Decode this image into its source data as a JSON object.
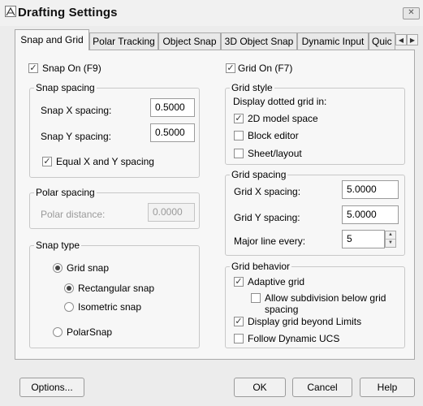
{
  "window": {
    "title": "Drafting Settings",
    "close_glyph": "✕"
  },
  "tabs": [
    {
      "label": "Snap and Grid",
      "active": true
    },
    {
      "label": "Polar Tracking"
    },
    {
      "label": "Object Snap"
    },
    {
      "label": "3D Object Snap"
    },
    {
      "label": "Dynamic Input"
    },
    {
      "label": "Quic"
    }
  ],
  "tab_scroll": {
    "left": "◀",
    "right": "▶"
  },
  "snap": {
    "snap_on": {
      "label": "Snap On (F9)",
      "checked": true
    },
    "spacing": {
      "title": "Snap spacing",
      "x_label": "Snap X spacing:",
      "x_value": "0.5000",
      "y_label": "Snap Y spacing:",
      "y_value": "0.5000",
      "equal": {
        "label": "Equal X and Y spacing",
        "checked": true
      }
    },
    "polar": {
      "title": "Polar spacing",
      "label": "Polar distance:",
      "value": "0.0000"
    },
    "type": {
      "title": "Snap type",
      "grid_snap": {
        "label": "Grid snap",
        "selected": true
      },
      "rectangular": {
        "label": "Rectangular snap",
        "selected": true
      },
      "isometric": {
        "label": "Isometric snap",
        "selected": false
      },
      "polarsnap": {
        "label": "PolarSnap",
        "selected": false
      }
    }
  },
  "grid": {
    "grid_on": {
      "label": "Grid On (F7)",
      "checked": true
    },
    "style": {
      "title": "Grid style",
      "subtitle": "Display dotted grid in:",
      "model": {
        "label": "2D model space",
        "checked": true
      },
      "block": {
        "label": "Block editor",
        "checked": false
      },
      "sheet": {
        "label": "Sheet/layout",
        "checked": false
      }
    },
    "spacing": {
      "title": "Grid spacing",
      "x_label": "Grid X spacing:",
      "x_value": "5.0000",
      "y_label": "Grid Y spacing:",
      "y_value": "5.0000",
      "major_label": "Major line every:",
      "major_value": "5",
      "spin_up": "▲",
      "spin_down": "▼"
    },
    "behavior": {
      "title": "Grid behavior",
      "adaptive": {
        "label": "Adaptive grid",
        "checked": true
      },
      "subdivision": {
        "label_line1": "Allow subdivision below grid",
        "label_line2": "spacing",
        "checked": false
      },
      "beyond": {
        "label": "Display grid beyond Limits",
        "checked": true
      },
      "ucs": {
        "label": "Follow Dynamic UCS",
        "checked": false
      }
    }
  },
  "buttons": {
    "options": "Options...",
    "ok": "OK",
    "cancel": "Cancel",
    "help": "Help"
  },
  "check_glyph": "✓"
}
